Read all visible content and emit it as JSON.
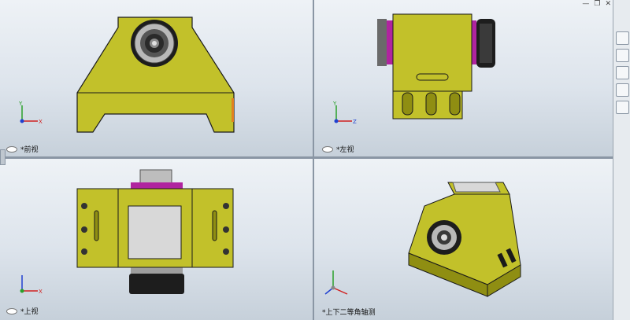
{
  "viewports": {
    "front": {
      "label": "*前视"
    },
    "left": {
      "label": "*左视"
    },
    "top": {
      "label": "*上视"
    },
    "iso": {
      "label": "*上下二等角轴测"
    }
  },
  "triad": {
    "x": "X",
    "y": "Y",
    "z": "Z"
  },
  "colors": {
    "body": "#c2c12a",
    "body_dark": "#8f8e12",
    "outline": "#1a1a1a",
    "magenta": "#b0249f",
    "plate": "#d8d8d8",
    "accent": "#e08020"
  },
  "icons": [
    "view-toolbar-icons",
    "minimize-icon",
    "restore-icon",
    "close-icon",
    "home-icon",
    "folder-icon",
    "appearance-icon",
    "notes-icon"
  ]
}
